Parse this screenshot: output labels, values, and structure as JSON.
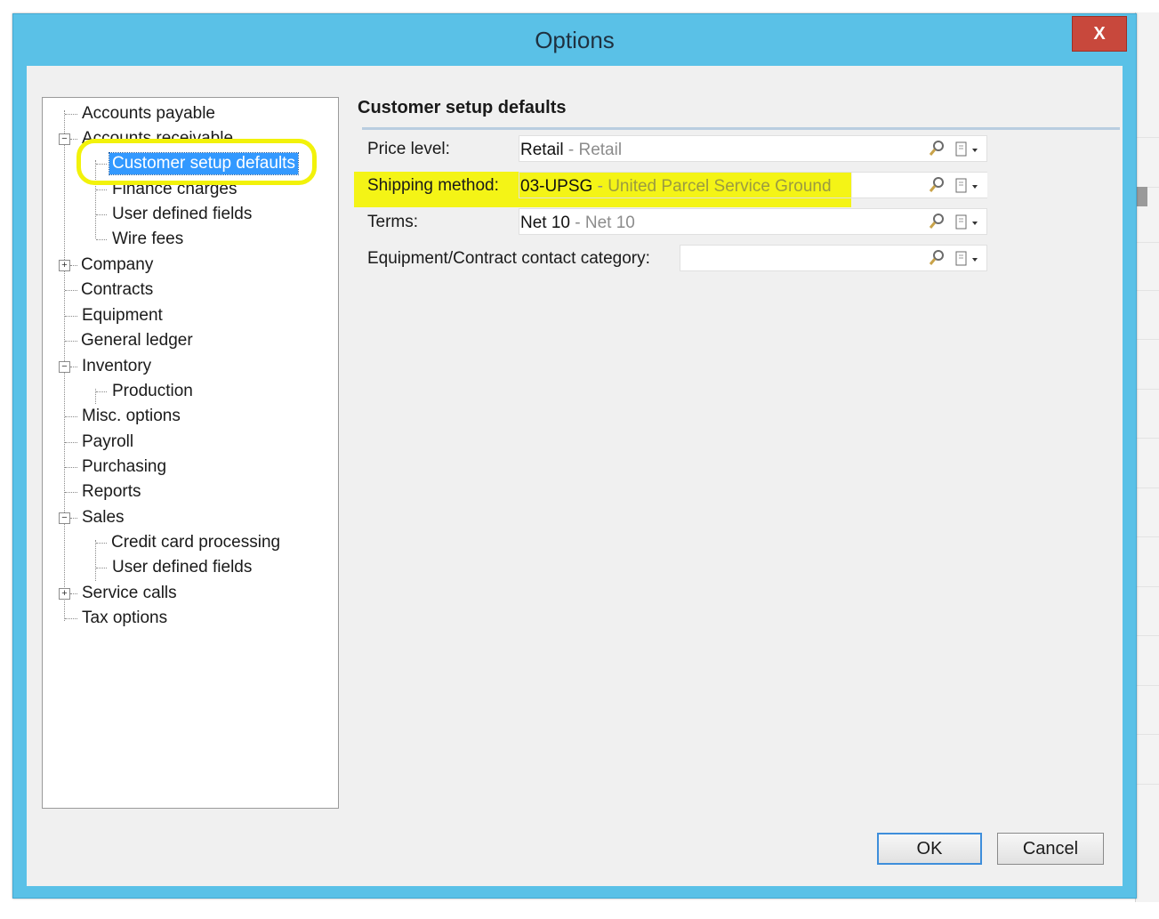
{
  "window": {
    "title": "Options",
    "close_label": "X"
  },
  "tree": {
    "items": [
      {
        "label": "Accounts payable",
        "level": 0
      },
      {
        "label": "Accounts receivable",
        "level": 0,
        "expanded": true
      },
      {
        "label": "Customer setup defaults",
        "level": 1,
        "selected": true
      },
      {
        "label": "Finance charges",
        "level": 1
      },
      {
        "label": "User defined fields",
        "level": 1
      },
      {
        "label": "Wire fees",
        "level": 1
      },
      {
        "label": "Company",
        "level": 0,
        "expanded": false
      },
      {
        "label": "Contracts",
        "level": 0
      },
      {
        "label": "Equipment",
        "level": 0
      },
      {
        "label": "General ledger",
        "level": 0
      },
      {
        "label": "Inventory",
        "level": 0,
        "expanded": true
      },
      {
        "label": "Production",
        "level": 1
      },
      {
        "label": "Misc. options",
        "level": 0
      },
      {
        "label": "Payroll",
        "level": 0
      },
      {
        "label": "Purchasing",
        "level": 0
      },
      {
        "label": "Reports",
        "level": 0
      },
      {
        "label": "Sales",
        "level": 0,
        "expanded": true
      },
      {
        "label": "Credit card processing",
        "level": 1
      },
      {
        "label": "User defined fields",
        "level": 1
      },
      {
        "label": "Service calls",
        "level": 0,
        "expanded": false
      },
      {
        "label": "Tax options",
        "level": 0
      }
    ]
  },
  "section": {
    "title": "Customer setup defaults",
    "rows": [
      {
        "label": "Price level:",
        "code": "Retail",
        "sep": " - ",
        "desc": "Retail"
      },
      {
        "label": "Shipping method:",
        "code": "03-UPSG",
        "sep": " - ",
        "desc": "United Parcel Service Ground"
      },
      {
        "label": "Terms:",
        "code": "Net 10",
        "sep": " - ",
        "desc": "Net 10"
      },
      {
        "label": "Equipment/Contract contact category:",
        "code": "",
        "sep": "",
        "desc": ""
      }
    ],
    "icons": {
      "lookup": "magnifier-icon",
      "menu": "document-dropdown-icon"
    }
  },
  "buttons": {
    "ok": "OK",
    "cancel": "Cancel"
  },
  "colors": {
    "titlebar": "#5ac1e7",
    "close": "#c8483c",
    "selection": "#3399ff",
    "annotation": "#f2f20a"
  }
}
